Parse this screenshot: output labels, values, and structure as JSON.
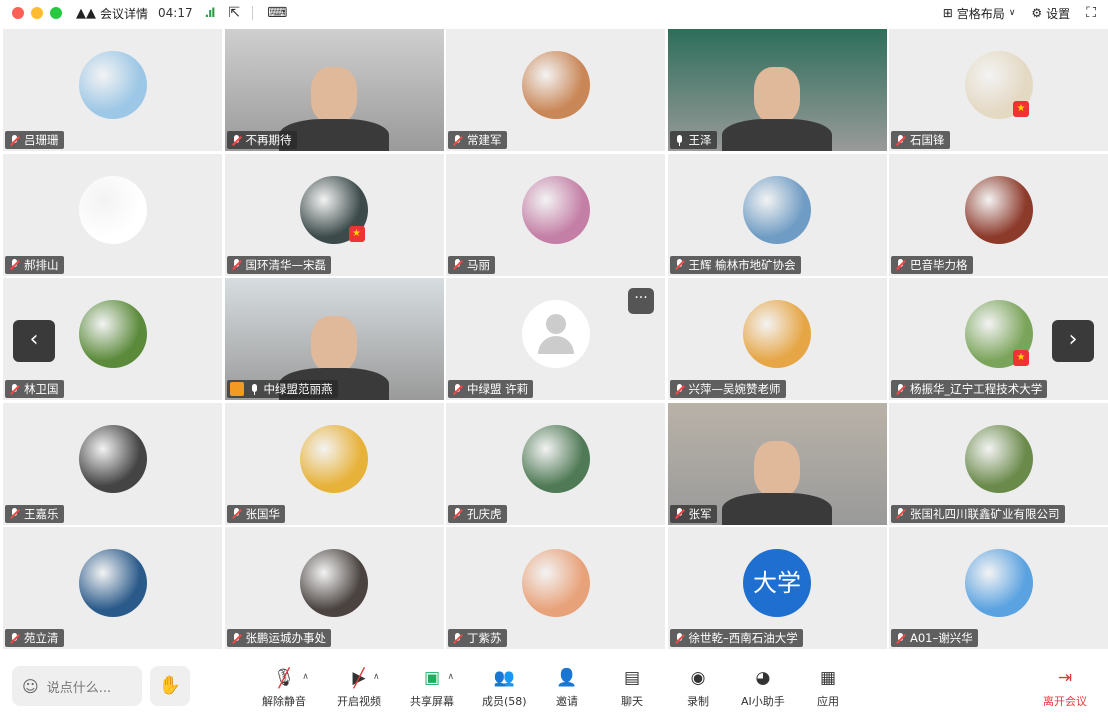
{
  "header": {
    "meeting_details_label": "会议详情",
    "timer": "04:17",
    "layout_label": "宫格布局",
    "settings_label": "设置"
  },
  "participants": [
    {
      "name": "吕珊珊",
      "type": "avatar",
      "avatar_color": "#9cc7e6"
    },
    {
      "name": "不再期待",
      "type": "video",
      "avatar_color": "#cfcfcf"
    },
    {
      "name": "常建军",
      "type": "avatar",
      "avatar_color": "#c98656"
    },
    {
      "name": "王泽",
      "type": "video",
      "avatar_color": "#2e6e5a"
    },
    {
      "name": "石国锋",
      "type": "avatar",
      "avatar_color": "#e4d9c3"
    },
    {
      "name": "郝排山",
      "type": "avatar",
      "avatar_color": "#ffffff"
    },
    {
      "name": "国环清华—宋磊",
      "type": "avatar",
      "avatar_color": "#3c4a4a"
    },
    {
      "name": "马丽",
      "type": "avatar",
      "avatar_color": "#c47fa6"
    },
    {
      "name": "王辉  榆林市地矿协会",
      "type": "avatar",
      "avatar_color": "#6f9cc4"
    },
    {
      "name": "巴音毕力格",
      "type": "avatar",
      "avatar_color": "#8c3a2a"
    },
    {
      "name": "林卫国",
      "type": "avatar",
      "avatar_color": "#5a8a3a"
    },
    {
      "name": "中绿盟范丽燕",
      "type": "video",
      "avatar_color": "#d7dde0"
    },
    {
      "name": "中绿盟 许莉",
      "type": "default",
      "avatar_color": "#ffffff"
    },
    {
      "name": "兴萍—吴婉赞老师",
      "type": "avatar",
      "avatar_color": "#e6a646"
    },
    {
      "name": "杨振华_辽宁工程技术大学",
      "type": "avatar",
      "avatar_color": "#7aa45a"
    },
    {
      "name": "王嘉乐",
      "type": "avatar",
      "avatar_color": "#444444"
    },
    {
      "name": "张国华",
      "type": "avatar",
      "avatar_color": "#e7b23a"
    },
    {
      "name": "孔庆虎",
      "type": "avatar",
      "avatar_color": "#4f7a55"
    },
    {
      "name": "张军",
      "type": "video",
      "avatar_color": "#b9b2a8"
    },
    {
      "name": "张国礼四川联鑫矿业有限公司",
      "type": "avatar",
      "avatar_color": "#6a8a4a"
    },
    {
      "name": "苑立清",
      "type": "avatar",
      "avatar_color": "#2a5a8a"
    },
    {
      "name": "张鹏运城办事处",
      "type": "avatar",
      "avatar_color": "#4a4340"
    },
    {
      "name": "丁紫苏",
      "type": "avatar",
      "avatar_color": "#e8a27a"
    },
    {
      "name": "徐世乾–西南石油大学",
      "type": "text_avatar",
      "avatar_text": "大学",
      "avatar_color": "#1e6fd0"
    },
    {
      "name": "A01–谢兴华",
      "type": "avatar",
      "avatar_color": "#5aa2e0"
    }
  ],
  "bottom": {
    "say_placeholder": "说点什么...",
    "mute_label": "解除静音",
    "video_label": "开启视频",
    "share_label": "共享屏幕",
    "members_label": "成员(58)",
    "invite_label": "邀请",
    "chat_label": "聊天",
    "record_label": "录制",
    "ai_label": "AI小助手",
    "apps_label": "应用",
    "leave_label": "离开会议"
  },
  "colors": {
    "leave": "#e03a3a",
    "active_speaker": "#3fcf7d",
    "signal": "#25a244"
  }
}
